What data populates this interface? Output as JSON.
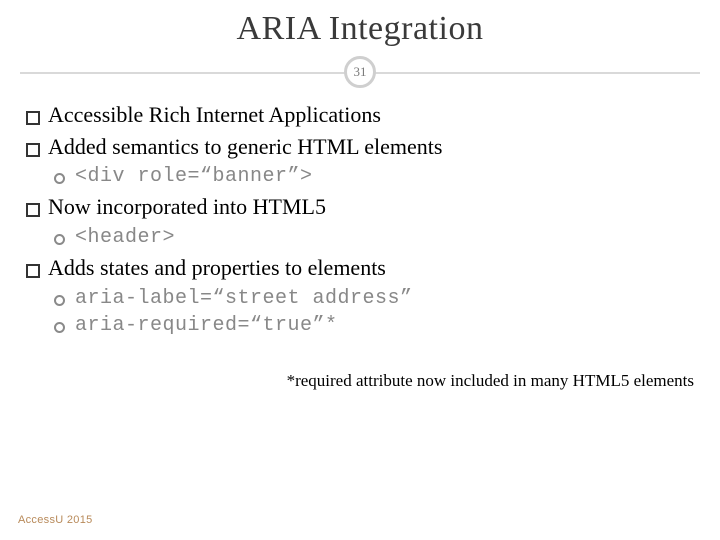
{
  "slide": {
    "title": "ARIA Integration",
    "page_number": "31",
    "bullets": [
      {
        "text": "Accessible Rich Internet Applications",
        "subs": []
      },
      {
        "text": "Added semantics to generic HTML elements",
        "subs": [
          {
            "code": "<div role=“banner”>"
          }
        ]
      },
      {
        "text": "Now incorporated into HTML5",
        "subs": [
          {
            "code": "<header>"
          }
        ]
      },
      {
        "text": "Adds states and properties to elements",
        "subs": [
          {
            "code": "aria-label=“street address”"
          },
          {
            "code": "aria-required=“true”*"
          }
        ]
      }
    ],
    "footnote": "*required attribute now included in many HTML5 elements",
    "footer": "AccessU 2015"
  }
}
